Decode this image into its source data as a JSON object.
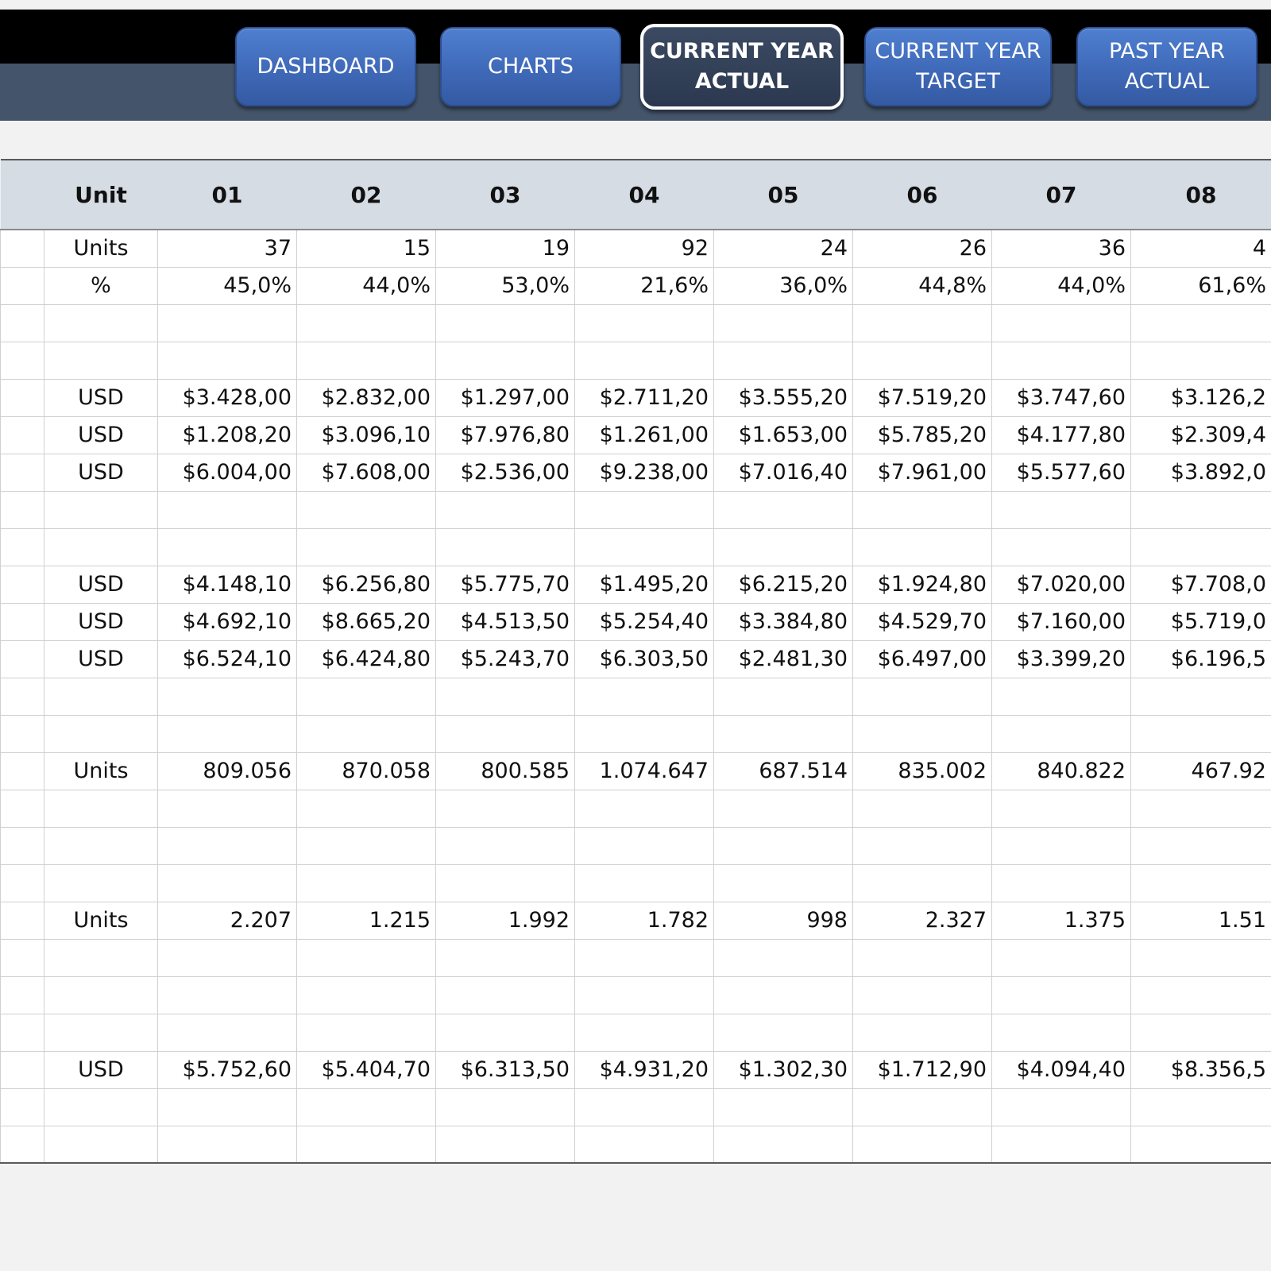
{
  "nav": {
    "buttons": [
      {
        "label": "DASHBOARD",
        "active": false
      },
      {
        "label": "CHARTS",
        "active": false
      },
      {
        "label": "CURRENT YEAR\nACTUAL",
        "active": true
      },
      {
        "label": "CURRENT YEAR\nTARGET",
        "active": false
      },
      {
        "label": "PAST YEAR\nACTUAL",
        "active": false
      }
    ]
  },
  "table": {
    "headers": [
      "",
      "Unit",
      "01",
      "02",
      "03",
      "04",
      "05",
      "06",
      "07",
      "08"
    ],
    "rows": [
      {
        "unit": "Units",
        "values": [
          "37",
          "15",
          "19",
          "92",
          "24",
          "26",
          "36",
          "4"
        ]
      },
      {
        "unit": "%",
        "values": [
          "45,0%",
          "44,0%",
          "53,0%",
          "21,6%",
          "36,0%",
          "44,8%",
          "44,0%",
          "61,6%"
        ]
      },
      {
        "unit": "",
        "values": [
          "",
          "",
          "",
          "",
          "",
          "",
          "",
          ""
        ]
      },
      {
        "unit": "",
        "values": [
          "",
          "",
          "",
          "",
          "",
          "",
          "",
          ""
        ]
      },
      {
        "unit": "USD",
        "values": [
          "$3.428,00",
          "$2.832,00",
          "$1.297,00",
          "$2.711,20",
          "$3.555,20",
          "$7.519,20",
          "$3.747,60",
          "$3.126,2"
        ]
      },
      {
        "unit": "USD",
        "values": [
          "$1.208,20",
          "$3.096,10",
          "$7.976,80",
          "$1.261,00",
          "$1.653,00",
          "$5.785,20",
          "$4.177,80",
          "$2.309,4"
        ]
      },
      {
        "unit": "USD",
        "values": [
          "$6.004,00",
          "$7.608,00",
          "$2.536,00",
          "$9.238,00",
          "$7.016,40",
          "$7.961,00",
          "$5.577,60",
          "$3.892,0"
        ]
      },
      {
        "unit": "",
        "values": [
          "",
          "",
          "",
          "",
          "",
          "",
          "",
          ""
        ]
      },
      {
        "unit": "",
        "values": [
          "",
          "",
          "",
          "",
          "",
          "",
          "",
          ""
        ]
      },
      {
        "unit": "USD",
        "values": [
          "$4.148,10",
          "$6.256,80",
          "$5.775,70",
          "$1.495,20",
          "$6.215,20",
          "$1.924,80",
          "$7.020,00",
          "$7.708,0"
        ]
      },
      {
        "unit": "USD",
        "values": [
          "$4.692,10",
          "$8.665,20",
          "$4.513,50",
          "$5.254,40",
          "$3.384,80",
          "$4.529,70",
          "$7.160,00",
          "$5.719,0"
        ]
      },
      {
        "unit": "USD",
        "values": [
          "$6.524,10",
          "$6.424,80",
          "$5.243,70",
          "$6.303,50",
          "$2.481,30",
          "$6.497,00",
          "$3.399,20",
          "$6.196,5"
        ]
      },
      {
        "unit": "",
        "values": [
          "",
          "",
          "",
          "",
          "",
          "",
          "",
          ""
        ]
      },
      {
        "unit": "",
        "values": [
          "",
          "",
          "",
          "",
          "",
          "",
          "",
          ""
        ]
      },
      {
        "unit": "Units",
        "values": [
          "809.056",
          "870.058",
          "800.585",
          "1.074.647",
          "687.514",
          "835.002",
          "840.822",
          "467.92"
        ]
      },
      {
        "unit": "",
        "values": [
          "",
          "",
          "",
          "",
          "",
          "",
          "",
          ""
        ]
      },
      {
        "unit": "",
        "values": [
          "",
          "",
          "",
          "",
          "",
          "",
          "",
          ""
        ]
      },
      {
        "unit": "",
        "values": [
          "",
          "",
          "",
          "",
          "",
          "",
          "",
          ""
        ]
      },
      {
        "unit": "Units",
        "values": [
          "2.207",
          "1.215",
          "1.992",
          "1.782",
          "998",
          "2.327",
          "1.375",
          "1.51"
        ]
      },
      {
        "unit": "",
        "values": [
          "",
          "",
          "",
          "",
          "",
          "",
          "",
          ""
        ]
      },
      {
        "unit": "",
        "values": [
          "",
          "",
          "",
          "",
          "",
          "",
          "",
          ""
        ]
      },
      {
        "unit": "",
        "values": [
          "",
          "",
          "",
          "",
          "",
          "",
          "",
          ""
        ]
      },
      {
        "unit": "USD",
        "values": [
          "$5.752,60",
          "$5.404,70",
          "$6.313,50",
          "$4.931,20",
          "$1.302,30",
          "$1.712,90",
          "$4.094,40",
          "$8.356,5"
        ]
      },
      {
        "unit": "",
        "values": [
          "",
          "",
          "",
          "",
          "",
          "",
          "",
          ""
        ]
      },
      {
        "unit": "",
        "values": [
          "",
          "",
          "",
          "",
          "",
          "",
          "",
          ""
        ]
      }
    ]
  }
}
